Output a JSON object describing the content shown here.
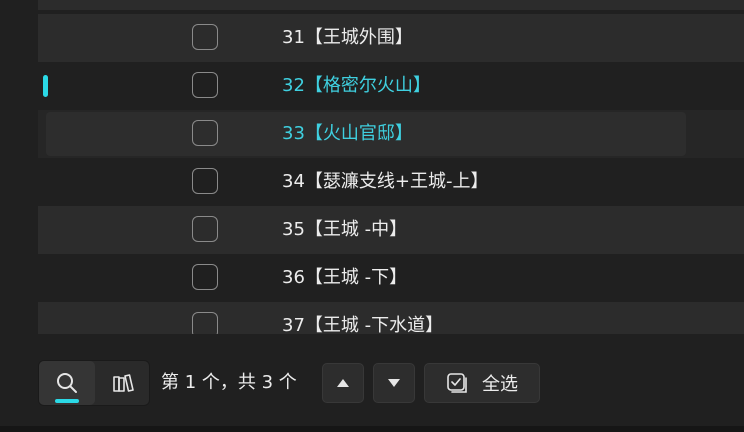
{
  "list": {
    "items": [
      {
        "label": "31【王城外围】",
        "highlight": false
      },
      {
        "label": "32【格密尔火山】",
        "highlight": true
      },
      {
        "label": "33【火山官邸】",
        "highlight": true
      },
      {
        "label": "34【瑟濂支线+王城-上】",
        "highlight": false
      },
      {
        "label": "35【王城 -中】",
        "highlight": false
      },
      {
        "label": "36【王城 -下】",
        "highlight": false
      },
      {
        "label": "37【王城 -下水道】",
        "highlight": false
      }
    ]
  },
  "toolbar": {
    "counter": "第 1 个，共 3 个",
    "select_all_label": "全选"
  },
  "colors": {
    "accent": "#2bd9e6",
    "accent_text": "#3fd0e0",
    "background": "#202020"
  }
}
